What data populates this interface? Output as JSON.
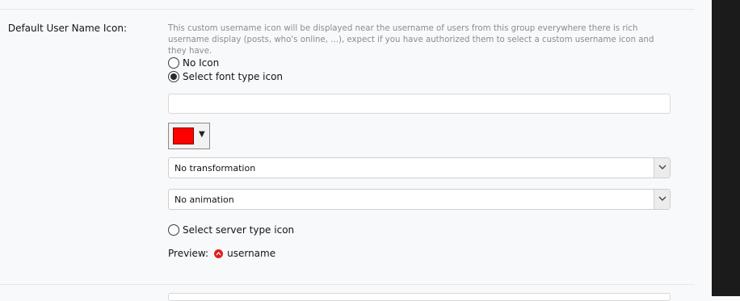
{
  "field": {
    "label": "Default User Name Icon:",
    "explain": "This custom username icon will be displayed near the username of users from this group everywhere there is rich username display (posts, who's online, ...), expect if you have authorized them to select a custom username icon and they have."
  },
  "options": {
    "no_icon": "No Icon",
    "font_type": "Select font type icon",
    "server_type": "Select server type icon",
    "selected": "font_type"
  },
  "font_icon": {
    "value": "",
    "color": "#ff0000"
  },
  "transformation": {
    "selected": "No transformation"
  },
  "animation": {
    "selected": "No animation"
  },
  "preview": {
    "label": "Preview:",
    "username": "username"
  }
}
